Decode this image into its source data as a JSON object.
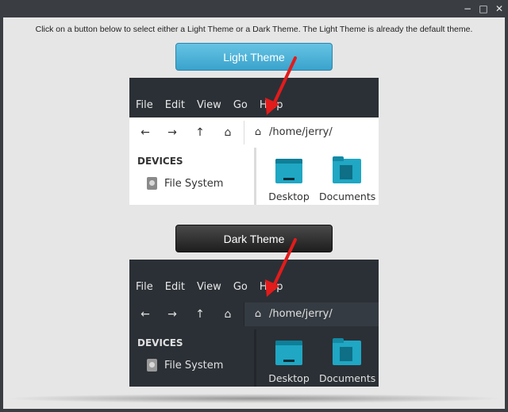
{
  "window": {
    "minimize_glyph": "−",
    "maximize_glyph": "□",
    "close_glyph": "✕"
  },
  "intro_text": "Click on a button below to select either a Light Theme or a Dark Theme. The Light Theme is already the default theme.",
  "buttons": {
    "light_label": "Light Theme",
    "dark_label": "Dark Theme"
  },
  "preview": {
    "menu": [
      "File",
      "Edit",
      "View",
      "Go",
      "Help"
    ],
    "toolbar_icons": {
      "back": "←",
      "forward": "→",
      "up": "↑",
      "home": "⌂"
    },
    "path": "/home/jerry/",
    "sidebar_heading": "DEVICES",
    "sidebar_item": "File System",
    "items": [
      "Desktop",
      "Documents"
    ]
  },
  "colors": {
    "light_button": "#3aa3cc",
    "dark_button": "#1e1e1e",
    "arrow": "#e31b1b",
    "folder": "#1fa7c4"
  },
  "icons": {
    "back": "arrow-left-icon",
    "forward": "arrow-right-icon",
    "up": "arrow-up-icon",
    "home": "home-icon",
    "drive": "drive-icon",
    "desktop": "desktop-folder-icon",
    "documents": "documents-folder-icon",
    "annotation": "red-arrow-icon"
  }
}
